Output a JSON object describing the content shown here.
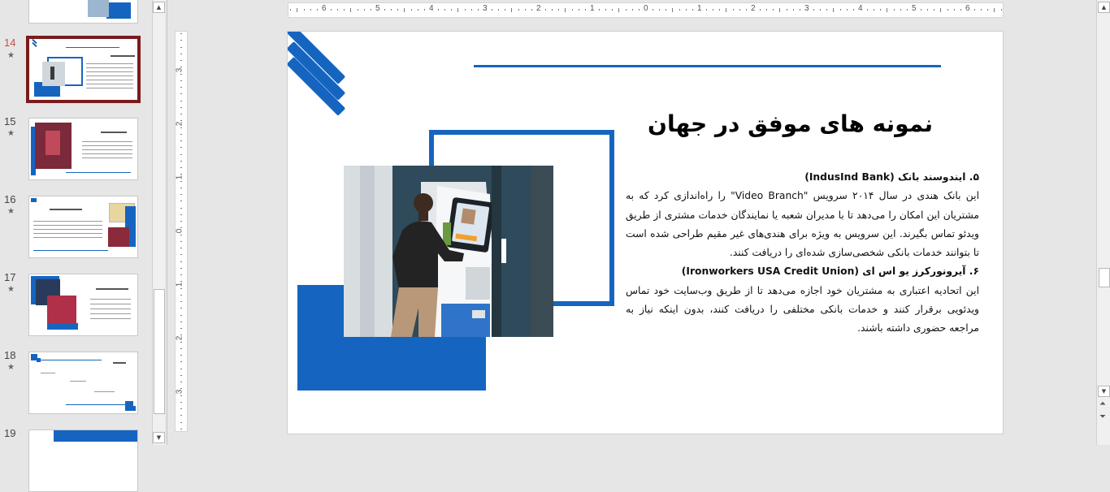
{
  "thumbnails": [
    {
      "num": "14",
      "star": "★",
      "selected": true
    },
    {
      "num": "15",
      "star": "★"
    },
    {
      "num": "16",
      "star": "★"
    },
    {
      "num": "17",
      "star": "★"
    },
    {
      "num": "18",
      "star": "★"
    },
    {
      "num": "19",
      "star": ""
    }
  ],
  "ruler": {
    "top": [
      "6",
      "5",
      "4",
      "3",
      "2",
      "1",
      "0",
      "1",
      "2",
      "3",
      "4",
      "5",
      "6"
    ],
    "left": [
      "3",
      "2",
      "1",
      "0",
      "1",
      "2",
      "3"
    ]
  },
  "slide": {
    "title": "نمونه های موفق در جهان",
    "p1_heading": "۵. ایندوسند بانک (IndusInd Bank)",
    "p1_text": "این بانک هندی در سال ۲۰۱۴ سرویس \"Video Branch\" را راه‌اندازی کرد که به مشتریان این امکان را می‌دهد تا با مدیران شعبه یا نمایندگان خدمات مشتری از طریق ویدئو تماس بگیرند. این سرویس به ویژه برای هندی‌های غیر مقیم طراحی شده است تا بتوانند خدمات بانکی شخصی‌سازی شده‌ای را دریافت کنند.",
    "p2_heading": "۶. آیرونورکرز یو اس ای (Ironworkers USA Credit Union)",
    "p2_text": "این اتحادیه اعتباری به مشتریان خود اجازه می‌دهد تا از طریق وب‌سایت خود تماس ویدئویی برقرار کنند و خدمات بانکی مختلفی را دریافت کنند، بدون اینکه نیاز به مراجعه حضوری داشته باشند."
  },
  "colors": {
    "accent": "#1565c0",
    "selection": "#7a1b1b"
  }
}
